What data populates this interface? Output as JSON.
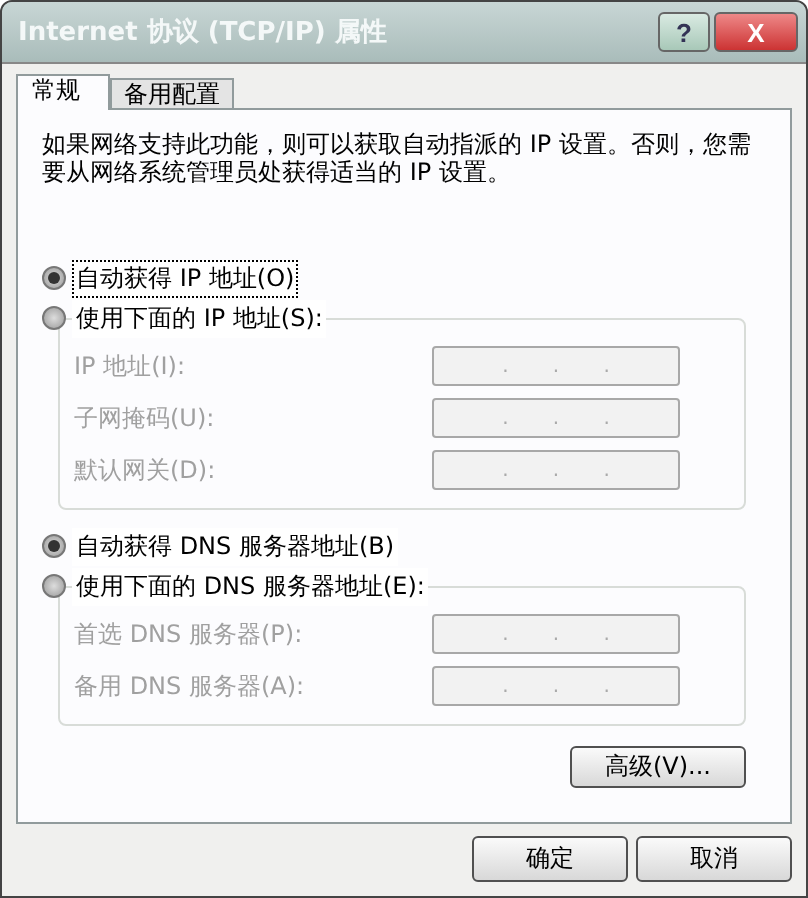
{
  "window": {
    "title": "Internet 协议 (TCP/IP) 属性",
    "help_button": "?",
    "close_button": "X"
  },
  "tabs": [
    {
      "label": "常规",
      "selected": true
    },
    {
      "label": "备用配置",
      "selected": false
    }
  ],
  "description": "如果网络支持此功能，则可以获取自动指派的 IP 设置。否则，您需要从网络系统管理员处获得适当的 IP 设置。",
  "ip_options": [
    {
      "label": "自动获得 IP 地址(O)",
      "selected": true,
      "focused": true
    },
    {
      "label": "使用下面的 IP 地址(S):",
      "selected": false,
      "focused": false
    }
  ],
  "ip_fields": [
    {
      "label": "IP 地址(I):",
      "disabled": true,
      "dots": [
        ".",
        ".",
        "."
      ]
    },
    {
      "label": "子网掩码(U):",
      "disabled": true,
      "dots": [
        ".",
        ".",
        "."
      ]
    },
    {
      "label": "默认网关(D):",
      "disabled": true,
      "dots": [
        ".",
        ".",
        "."
      ]
    }
  ],
  "dns_options": [
    {
      "label": "自动获得 DNS 服务器地址(B)",
      "selected": true,
      "focused": false
    },
    {
      "label": "使用下面的 DNS 服务器地址(E):",
      "selected": false,
      "focused": false
    }
  ],
  "dns_fields": [
    {
      "label": "首选 DNS 服务器(P):",
      "disabled": true,
      "dots": [
        ".",
        ".",
        "."
      ]
    },
    {
      "label": "备用 DNS 服务器(A):",
      "disabled": true,
      "dots": [
        ".",
        ".",
        "."
      ]
    }
  ],
  "advanced_button": "高级(V)...",
  "buttons": [
    "确定",
    "取消"
  ]
}
